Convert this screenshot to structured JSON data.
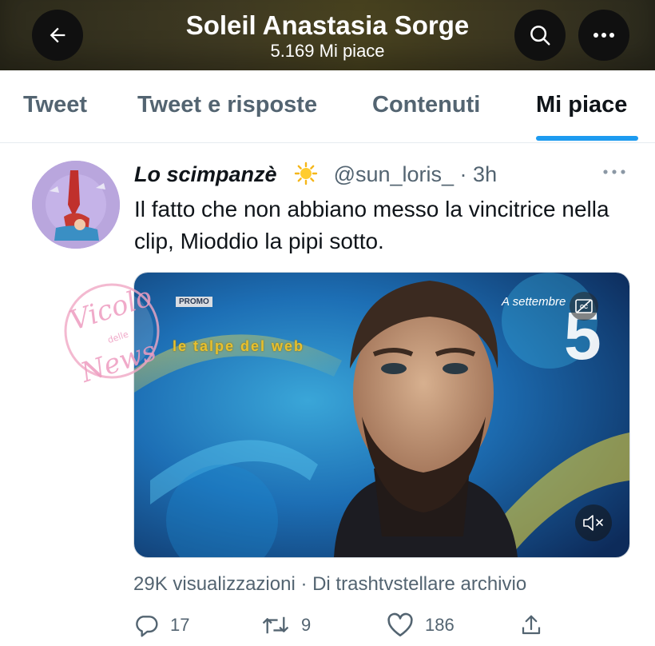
{
  "header": {
    "title": "Soleil Anastasia Sorge",
    "subtitle": "5.169 Mi piace"
  },
  "tabs": [
    {
      "label": "Tweet",
      "active": false
    },
    {
      "label": "Tweet e risposte",
      "active": false
    },
    {
      "label": "Contenuti",
      "active": false
    },
    {
      "label": "Mi piace",
      "active": true
    }
  ],
  "tweet": {
    "author_name": "Lo scimpanzè",
    "handle_time": "@sun_loris_ · 3h",
    "text": "Il fatto che non abbiano messo la vincitrice nella clip, Mioddio la pipi sotto.",
    "media": {
      "promo_label": "PROMO",
      "date_label": "A settembre",
      "channel_logo": "5",
      "watermark_moles": "le talpe del web"
    },
    "views_line": "29K visualizzazioni · Di trashtvstellare archivio",
    "stats": {
      "replies": "17",
      "retweets": "9",
      "likes": "186"
    }
  },
  "watermark": {
    "line1": "Vicolo",
    "line2": "delle",
    "line3": "News"
  },
  "colors": {
    "accent": "#1d9bf0",
    "secondary_text": "#536471",
    "primary_text": "#0f1419"
  },
  "icons": [
    "back-arrow-icon",
    "search-icon",
    "more-icon",
    "sun-emoji-icon",
    "cc-icon",
    "mute-icon",
    "reply-icon",
    "retweet-icon",
    "like-icon",
    "share-icon"
  ]
}
